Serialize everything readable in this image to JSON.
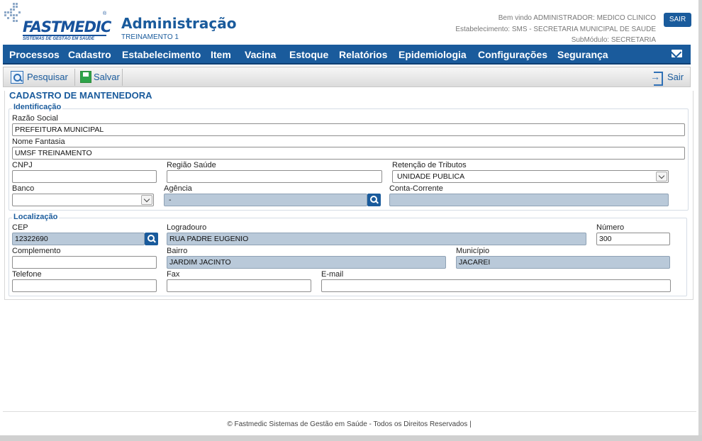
{
  "header": {
    "logo_text": "FASTMEDIC",
    "logo_tagline": "SISTEMAS DE GESTÃO EM SAÚDE",
    "title": "Administração",
    "subtitle": "TREINAMENTO 1",
    "welcome": "Bem vindo ADMINISTRADOR: MEDICO CLINICO",
    "establishment": "Estabelecimento: SMS - SECRETARIA MUNICIPAL DE SAUDE",
    "submodule": "SubMódulo: SECRETARIA",
    "logout_label": "SAIR"
  },
  "nav": {
    "items": [
      "Processos",
      "Cadastro",
      "Estabelecimento",
      "Item",
      "Vacina",
      "Estoque",
      "Relatórios",
      "Epidemiologia",
      "Configurações",
      "Segurança"
    ],
    "mail_icon": "envelope-icon"
  },
  "toolbar": {
    "search_label": "Pesquisar",
    "save_label": "Salvar",
    "exit_label": "Sair"
  },
  "form": {
    "title": "CADASTRO DE MANTENEDORA",
    "identificacao": {
      "legend": "Identificação",
      "razao_social_label": "Razão Social",
      "razao_social": "PREFEITURA MUNICIPAL",
      "nome_fantasia_label": "Nome Fantasia",
      "nome_fantasia": "UMSF TREINAMENTO",
      "cnpj_label": "CNPJ",
      "cnpj": "",
      "regiao_saude_label": "Região Saúde",
      "regiao_saude": "",
      "retencao_label": "Retenção de Tributos",
      "retencao": "UNIDADE PUBLICA",
      "banco_label": "Banco",
      "banco": "",
      "agencia_label": "Agência",
      "agencia": "-",
      "conta_label": "Conta-Corrente",
      "conta": ""
    },
    "localizacao": {
      "legend": "Localização",
      "cep_label": "CEP",
      "cep": "12322690",
      "logradouro_label": "Logradouro",
      "logradouro": "RUA PADRE EUGENIO",
      "numero_label": "Número",
      "numero": "300",
      "complemento_label": "Complemento",
      "complemento": "",
      "bairro_label": "Bairro",
      "bairro": "JARDIM JACINTO",
      "municipio_label": "Município",
      "municipio": "JACAREI",
      "telefone_label": "Telefone",
      "telefone": "",
      "fax_label": "Fax",
      "fax": "",
      "email_label": "E-mail",
      "email": ""
    }
  },
  "footer": {
    "text": "© Fastmedic Sistemas de Gestão em Saúde - Todos os Direitos Reservados |"
  },
  "colors": {
    "brand": "#1a5b9c",
    "readonly_field": "#b9c9d9"
  }
}
